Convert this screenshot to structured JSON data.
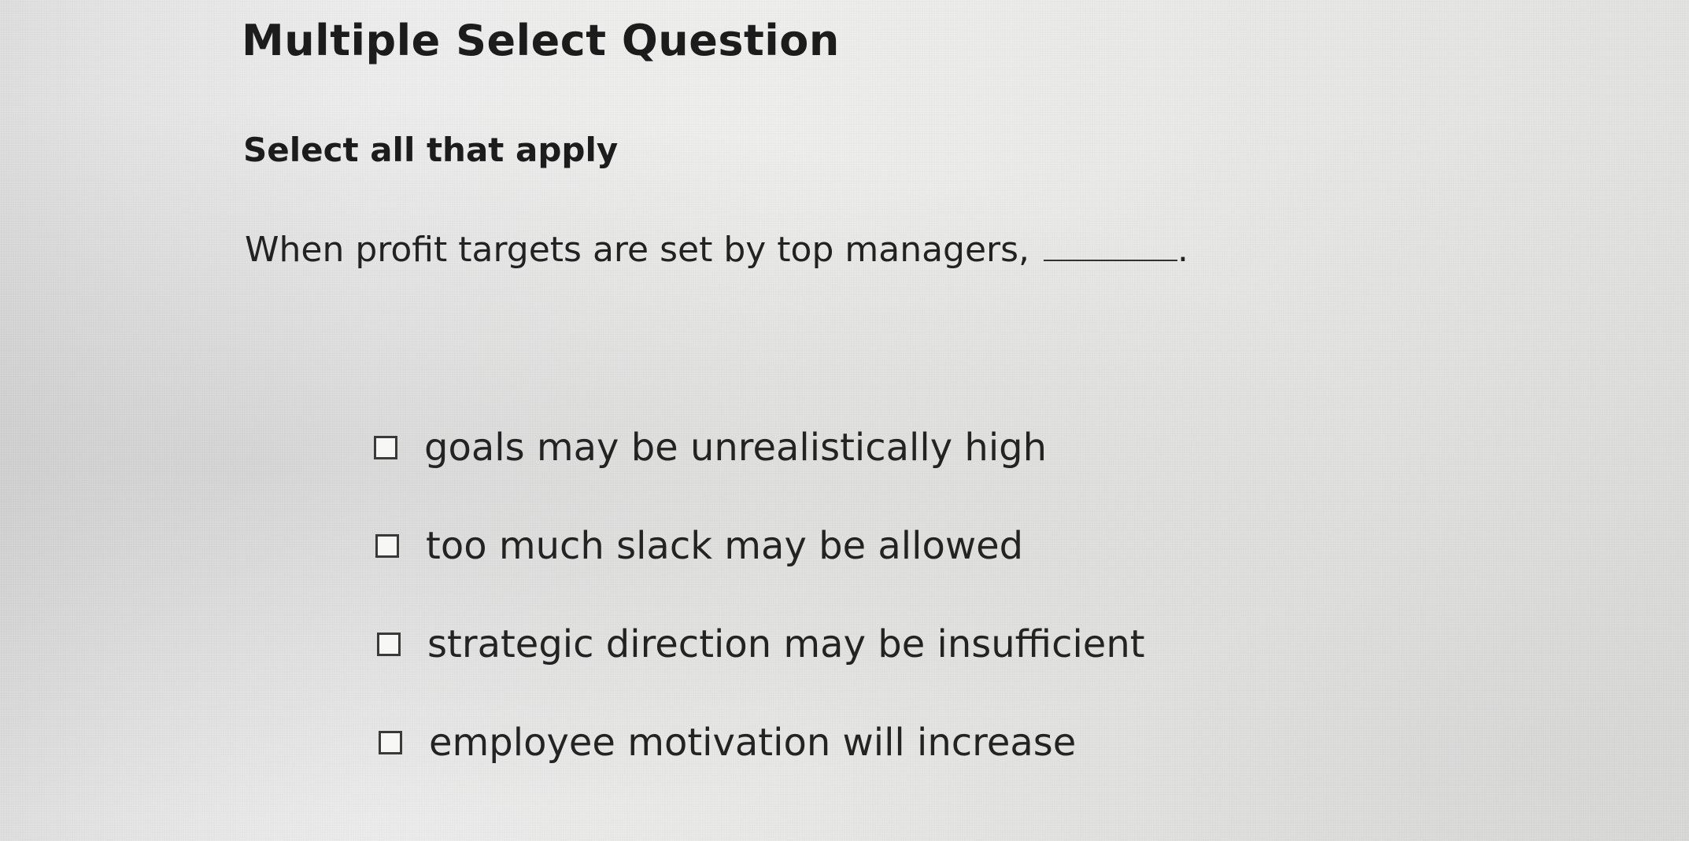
{
  "question": {
    "type_label": "Multiple Select Question",
    "instruction": "Select all that apply",
    "prompt": "When profit targets are set by top managers,",
    "prompt_end": "."
  },
  "options": [
    {
      "label": "goals may be unrealistically high",
      "checked": false
    },
    {
      "label": "too much slack may be allowed",
      "checked": false
    },
    {
      "label": "strategic direction may be insufficient",
      "checked": false
    },
    {
      "label": "employee motivation will increase",
      "checked": false
    }
  ],
  "colors": {
    "text": "#1c1c1c",
    "checkbox_border": "#3a3a3a",
    "background": "#ececeb"
  }
}
